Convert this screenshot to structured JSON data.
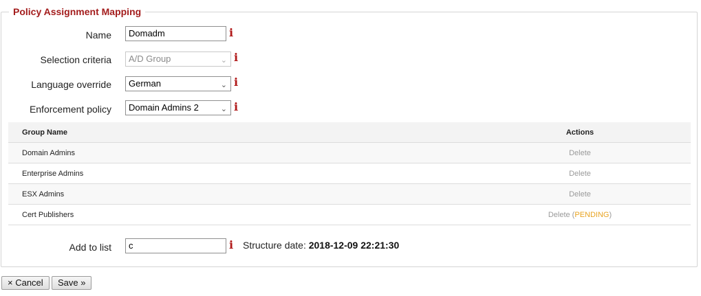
{
  "section": {
    "title": "Policy Assignment Mapping"
  },
  "form": {
    "name_label": "Name",
    "name_value": "Domadm",
    "selection_label": "Selection criteria",
    "selection_value": "A/D Group",
    "language_label": "Language override",
    "language_value": "German",
    "enforcement_label": "Enforcement policy",
    "enforcement_value": "Domain Admins 2",
    "info_glyph": "i"
  },
  "table": {
    "headers": {
      "group": "Group Name",
      "actions": "Actions"
    },
    "rows": [
      {
        "group": "Domain Admins",
        "action": "Delete",
        "status": ""
      },
      {
        "group": "Enterprise Admins",
        "action": "Delete",
        "status": ""
      },
      {
        "group": "ESX Admins",
        "action": "Delete",
        "status": ""
      },
      {
        "group": "Cert Publishers",
        "action": "Delete",
        "status": "PENDING"
      }
    ]
  },
  "add": {
    "label": "Add to list",
    "value": "c",
    "structure_label": "Structure date:",
    "structure_date": "2018-12-09 22:21:30"
  },
  "buttons": {
    "cancel": "× Cancel",
    "save": "Save »"
  },
  "colors": {
    "title": "#a31c1c",
    "info": "#b01818",
    "pending": "#e8a321"
  },
  "icons": {
    "info": "info-icon",
    "dropdown": "chevron-down-icon"
  }
}
